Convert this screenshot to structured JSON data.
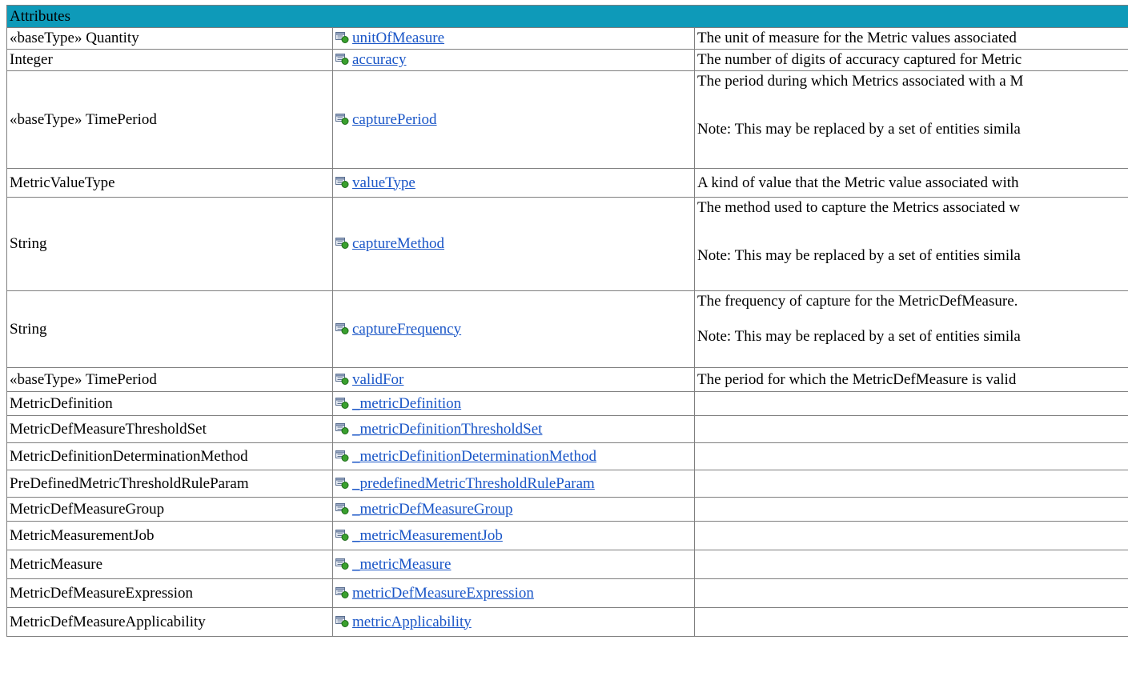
{
  "header": "Attributes",
  "rows": [
    {
      "type": "«baseType» Quantity",
      "name": "unitOfMeasure",
      "desc": [
        "The unit of measure for the Metric values associated"
      ]
    },
    {
      "type": "Integer",
      "name": "accuracy",
      "desc": [
        "The number of digits of accuracy captured for Metric"
      ]
    },
    {
      "type": "«baseType» TimePeriod",
      "name": "capturePeriod",
      "desc": [
        "The period during which Metrics associated with a M",
        "",
        "",
        "Note: This may be replaced by a set of entities simila"
      ]
    },
    {
      "type": "MetricValueType",
      "name": "valueType",
      "desc": [
        "A kind of value that the Metric value associated with"
      ]
    },
    {
      "type": "String",
      "name": "captureMethod",
      "desc": [
        "The method used to capture the Metrics associated w",
        "",
        "",
        "Note: This may be replaced by a set of entities simila"
      ]
    },
    {
      "type": "String",
      "name": "captureFrequency",
      "desc": [
        "The frequency of capture for the MetricDefMeasure.",
        "",
        "Note: This may be replaced by a set of entities simila"
      ]
    },
    {
      "type": "«baseType» TimePeriod",
      "name": "validFor",
      "desc": [
        "The period for which the MetricDefMeasure is valid"
      ]
    },
    {
      "type": "MetricDefinition",
      "name": "_metricDefinition",
      "desc": []
    },
    {
      "type": "MetricDefMeasureThresholdSet",
      "name": "_metricDefinitionThresholdSet",
      "desc": []
    },
    {
      "type": "MetricDefinitionDeterminationMethod",
      "name": "_metricDefinitionDeterminationMethod",
      "desc": []
    },
    {
      "type": "PreDefinedMetricThresholdRuleParam",
      "name": "_predefinedMetricThresholdRuleParam",
      "desc": []
    },
    {
      "type": "MetricDefMeasureGroup",
      "name": "_metricDefMeasureGroup",
      "desc": []
    },
    {
      "type": "MetricMeasurementJob",
      "name": "_metricMeasurementJob",
      "desc": []
    },
    {
      "type": "MetricMeasure",
      "name": "_metricMeasure",
      "desc": []
    },
    {
      "type": "MetricDefMeasureExpression",
      "name": "metricDefMeasureExpression",
      "desc": []
    },
    {
      "type": "MetricDefMeasureApplicability",
      "name": "metricApplicability",
      "desc": []
    }
  ],
  "colors": {
    "header_bg": "#0e9ab9",
    "link": "#1a56c7",
    "border": "#7f7f7f"
  },
  "icon_name": "attribute-icon"
}
